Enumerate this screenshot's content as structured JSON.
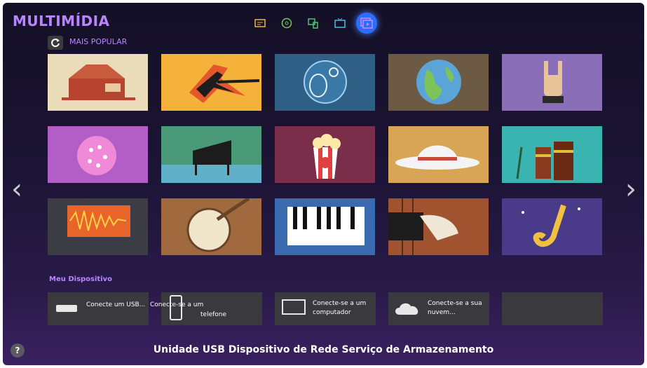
{
  "app": {
    "title": "MULTIMÍDIA"
  },
  "topnav": {
    "icons": [
      "tv-guide-icon",
      "apps-icon",
      "devices-icon",
      "tv-icon",
      "multimedia-icon"
    ],
    "active": "multimedia-icon"
  },
  "section": {
    "popular_label": "MAIS POPULAR"
  },
  "genres": [
    "barn-tile",
    "electric-guitar-tile",
    "folk-musician-tile",
    "world-globe-tile",
    "rock-hand-tile",
    "disco-ball-tile",
    "grand-piano-tile",
    "popcorn-music-tile",
    "cowboy-hat-tile",
    "tropical-drums-tile",
    "sound-wave-tile",
    "banjo-tile",
    "keyboard-tile",
    "double-bass-tile",
    "saxophone-tile"
  ],
  "devices": {
    "label": "Meu Dispositivo",
    "usb": "Conecte um USB...",
    "phone_line1": "Conecte-se a um",
    "phone_line2": "telefone",
    "computer_line1": "Conecte-se a um",
    "computer_line2": "computador",
    "cloud_line1": "Conecte-se a sua",
    "cloud_line2": "nuvem..."
  },
  "footer": {
    "help": "?",
    "description": "Unidade USB Dispositivo de Rede Serviço de Armazenamento"
  },
  "colors": {
    "accent": "#b985ff",
    "highlight": "#2c6cff"
  }
}
